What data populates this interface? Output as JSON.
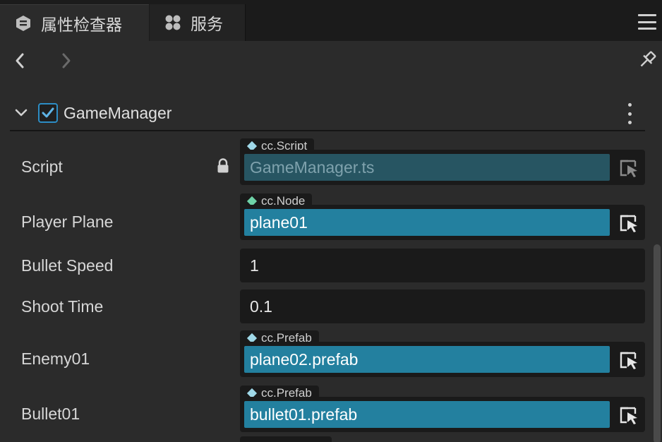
{
  "tabs": [
    {
      "label": "属性检查器",
      "icon": "inspector-icon",
      "active": true
    },
    {
      "label": "服务",
      "icon": "services-icon",
      "active": false
    }
  ],
  "component": {
    "name": "GameManager",
    "enabled": true
  },
  "properties": {
    "script": {
      "label": "Script",
      "type": "cc.Script",
      "value": "GameManager.ts",
      "locked": true
    },
    "player_plane": {
      "label": "Player Plane",
      "type": "cc.Node",
      "value": "plane01"
    },
    "bullet_speed": {
      "label": "Bullet Speed",
      "value": "1"
    },
    "shoot_time": {
      "label": "Shoot Time",
      "value": "0.1"
    },
    "enemy01": {
      "label": "Enemy01",
      "type": "cc.Prefab",
      "value": "plane02.prefab"
    },
    "bullet01": {
      "label": "Bullet01",
      "type": "cc.Prefab",
      "value": "bullet01.prefab"
    }
  },
  "colors": {
    "accent": "#2c8dc5",
    "asset_field": "#23809f",
    "node_diamond": "#6fd3a8",
    "asset_diamond": "#9fd8e8"
  }
}
